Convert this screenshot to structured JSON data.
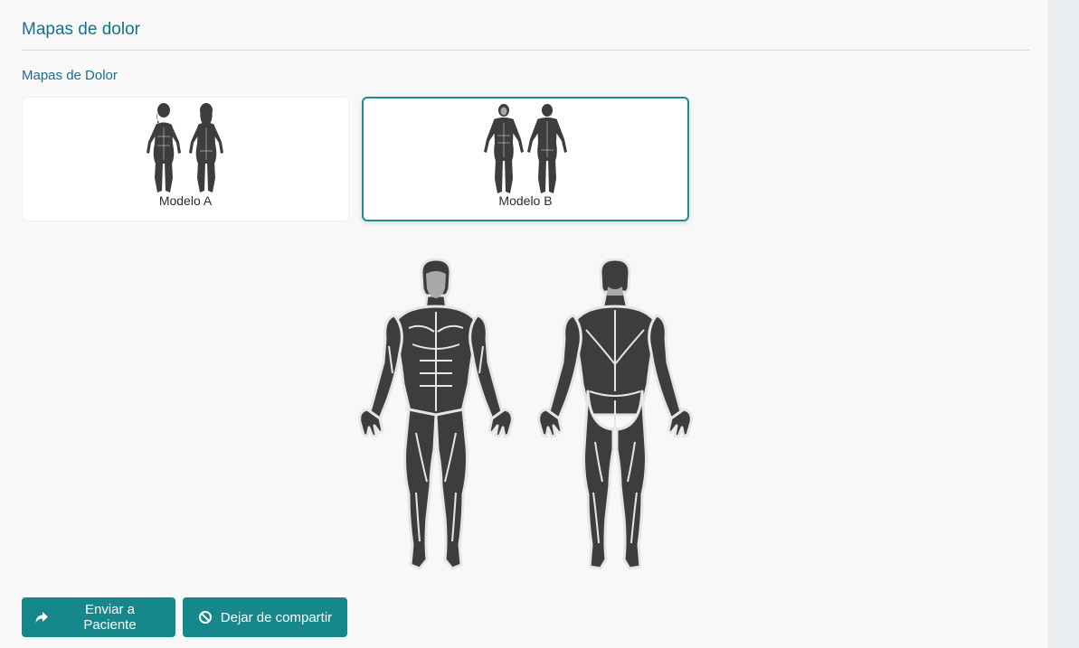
{
  "panel": {
    "title": "Mapas de dolor",
    "section_title": "Mapas de Dolor"
  },
  "models": [
    {
      "label": "Modelo A",
      "selected": false
    },
    {
      "label": "Modelo B",
      "selected": true
    }
  ],
  "actions": {
    "send_label": "Enviar a Paciente",
    "send_icon": "share-arrow-icon",
    "stop_label": "Dejar de compartir",
    "stop_icon": "ban-icon"
  },
  "colors": {
    "accent": "#16878a",
    "title": "#17708a",
    "selected_border": "#1e8c8c",
    "figure_muscle": "#3d3d3d",
    "figure_skin": "#a9a9a9"
  }
}
